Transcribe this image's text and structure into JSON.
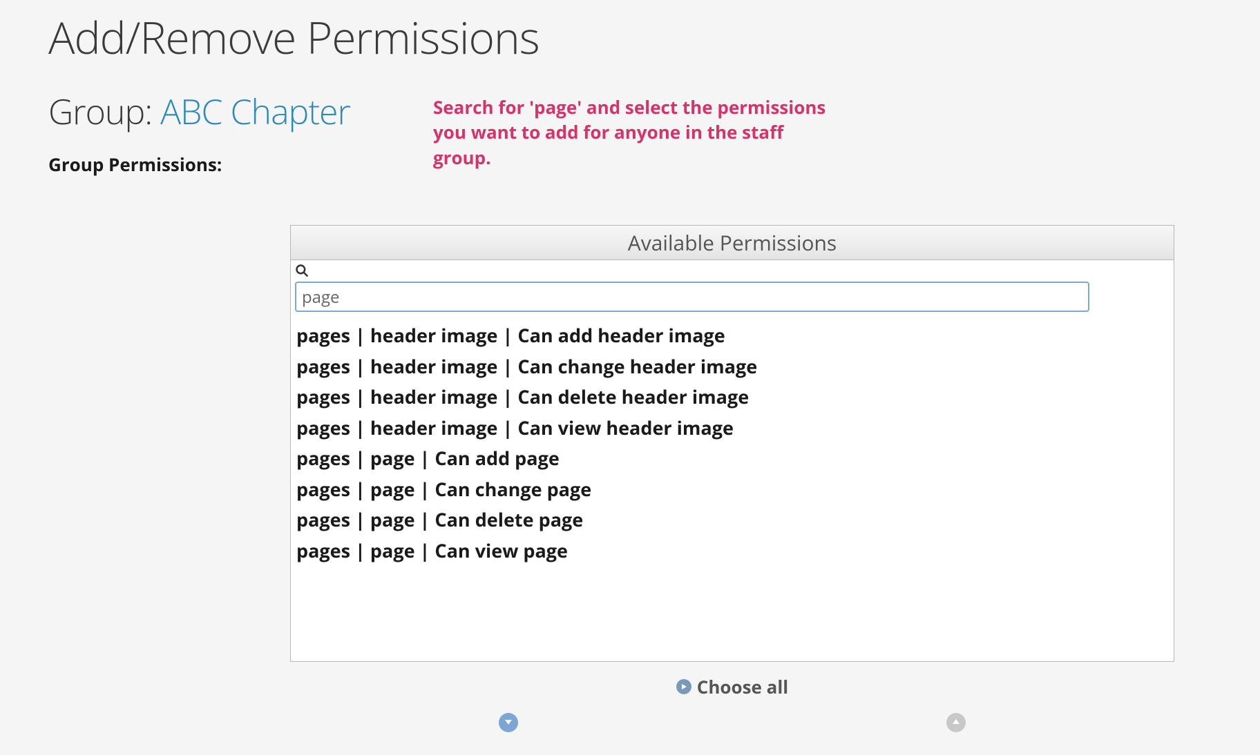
{
  "title": "Add/Remove Permissions",
  "group": {
    "label": "Group: ",
    "name": "ABC Chapter"
  },
  "instruction": "Search for 'page' and select the permissions you want to add for anyone in the staff group.",
  "permissions_label": "Group Permissions:",
  "panel": {
    "header": "Available Permissions",
    "search_value": "page",
    "items": [
      "pages | header image | Can add header image",
      "pages | header image | Can change header image",
      "pages | header image | Can delete header image",
      "pages | header image | Can view header image",
      "pages | page | Can add page",
      "pages | page | Can change page",
      "pages | page | Can delete page",
      "pages | page | Can view page"
    ],
    "choose_all_label": "Choose all"
  }
}
